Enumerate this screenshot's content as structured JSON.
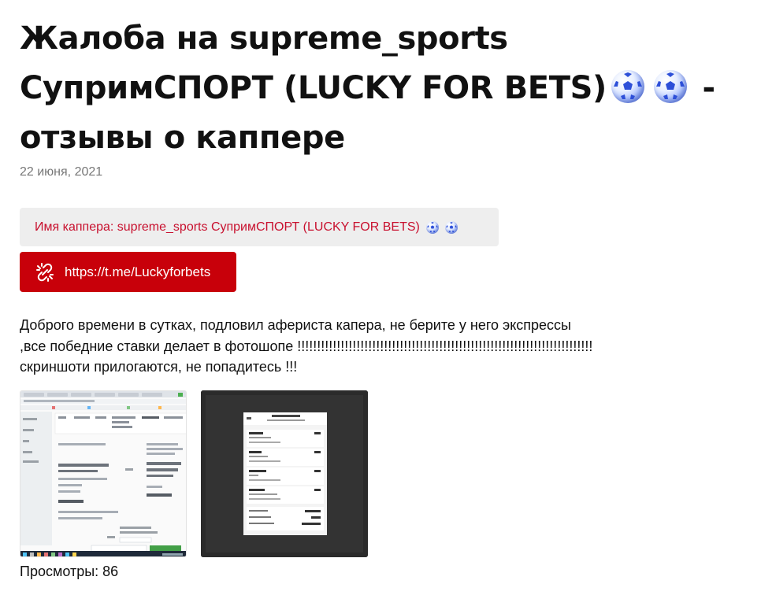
{
  "header": {
    "crop_text": "",
    "title_part1": "Жалоба на supreme_sports СупримСПОРТ (LUCKY FOR BETS)",
    "title_part2": "- отзывы о каппере",
    "title_icons": [
      "soccer-ball-icon",
      "soccer-ball-icon"
    ]
  },
  "meta": {
    "date": "22 июня, 2021"
  },
  "capper": {
    "label": "Имя каппера: supreme_sports СупримСПОРТ (LUCKY FOR BETS)",
    "icons": [
      "soccer-ball-icon",
      "soccer-ball-icon"
    ]
  },
  "link": {
    "text": "https://t.me/Luckyforbets",
    "icon": "broken-link-icon"
  },
  "review": {
    "lines": [
      "Доброго времени в сутках, подловил афериста капера, не берите у него экспрессы",
      ",все победние ставки делает в фотошопе !!!!!!!!!!!!!!!!!!!!!!!!!!!!!!!!!!!!!!!!!!!!!!!!!!!!!!!!!!!!!!!!!!!!!!!!!!!",
      "скриншоти прилогаются, не попадитесь !!!"
    ]
  },
  "footer": {
    "views": "Просмотры: 86"
  },
  "colors": {
    "accent_red": "#c8000a",
    "capper_text": "#c8102e",
    "box_bg": "#eeeeee",
    "date_gray": "#777777"
  }
}
